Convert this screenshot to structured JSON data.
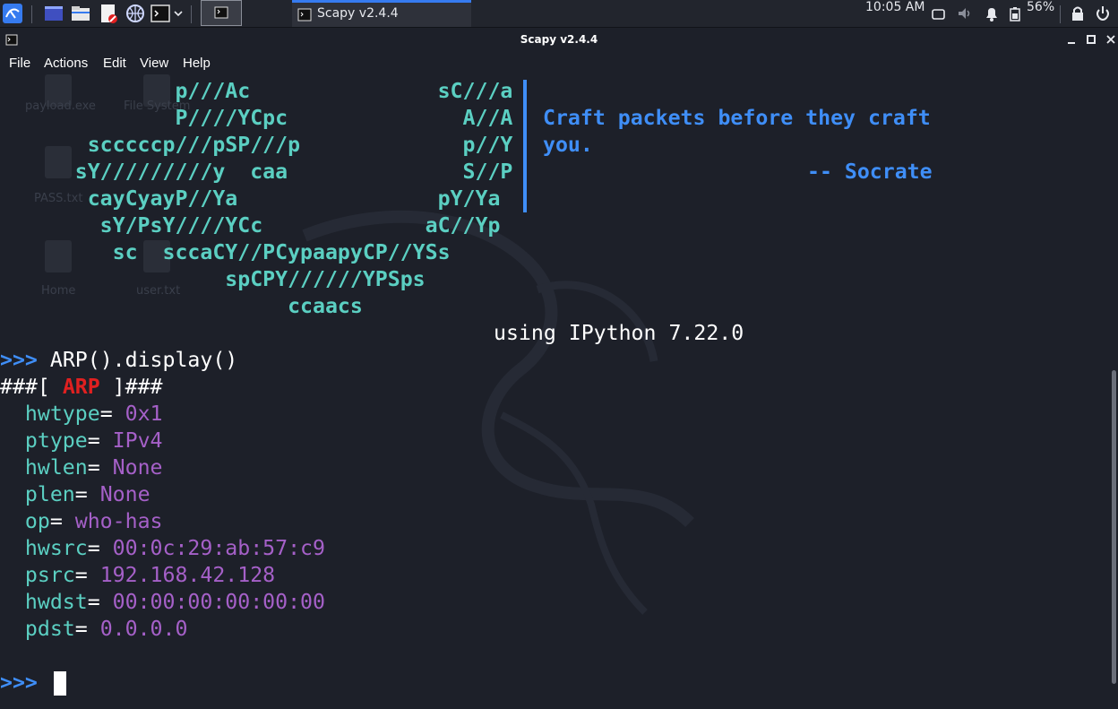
{
  "taskbar": {
    "active_task": "Scapy v2.4.4",
    "clock": "10:05 AM",
    "battery": "56%"
  },
  "window": {
    "title": "Scapy v2.4.4"
  },
  "menu": [
    "File",
    "Actions",
    "Edit",
    "View",
    "Help"
  ],
  "desktop_icons": [
    "payload.exe",
    "File System",
    "PASS.txt",
    "Home",
    "user.txt"
  ],
  "banner": {
    "art_lines": [
      "              p///Ac               sC///a",
      "              P////YCpc              A//A",
      "       scccccp///pSP///p             p//Y",
      "      sY/////////y  caa              S//P",
      "       cayCyayP//Ya                pY/Ya",
      "        sY/PsY////YCc             aC//Yp",
      "         sc  sccaCY//PCypaapyCP//YSs",
      "                  spCPY//////YPSps",
      "                       ccaacs"
    ],
    "quote_line1": "Craft packets before they craft",
    "quote_line2": "you.",
    "quote_author": "-- Socrate",
    "ipython": "using IPython 7.22.0"
  },
  "session": {
    "prompt": ">>>",
    "command": "ARP().display()",
    "layer_prefix": "###[ ",
    "layer_name": "ARP",
    "layer_suffix": " ]###",
    "fields": [
      {
        "name": "hwtype",
        "value": "0x1"
      },
      {
        "name": "ptype",
        "value": "IPv4"
      },
      {
        "name": "hwlen",
        "value": "None"
      },
      {
        "name": "plen",
        "value": "None"
      },
      {
        "name": "op",
        "value": "who-has"
      },
      {
        "name": "hwsrc",
        "value": "00:0c:29:ab:57:c9"
      },
      {
        "name": "psrc",
        "value": "192.168.42.128"
      },
      {
        "name": "hwdst",
        "value": "00:00:00:00:00:00"
      },
      {
        "name": "pdst",
        "value": "0.0.0.0"
      }
    ],
    "eq": "= "
  },
  "colors": {
    "background": "#1d2029",
    "art": "#5bcfc2",
    "quote": "#3f8ef7",
    "layer": "#e02020",
    "value": "#a560c8",
    "taskbar_accent": "#367bf0"
  }
}
